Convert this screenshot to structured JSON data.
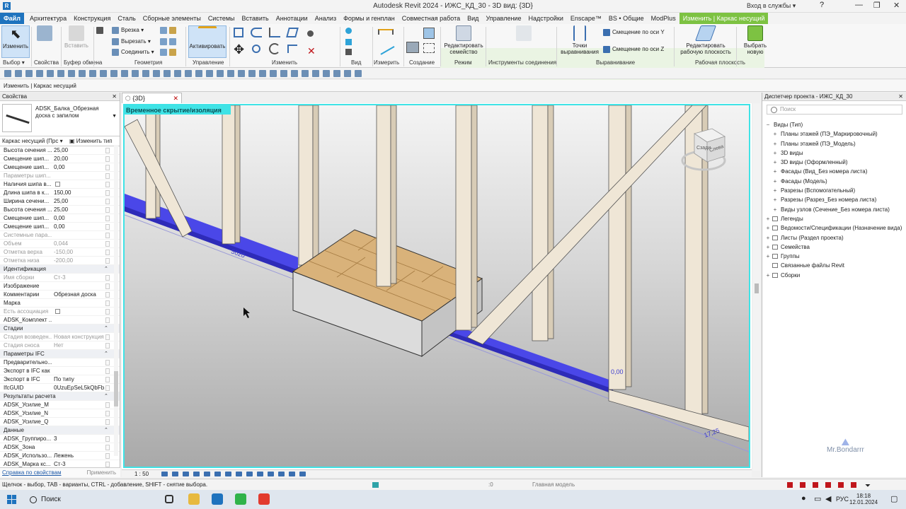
{
  "window": {
    "title": "Autodesk Revit 2024 - ИЖС_КД_30 - 3D вид: {3D}",
    "sign_in": "Вход в службы ▾",
    "controls": [
      "—",
      "❐",
      "✕"
    ]
  },
  "ribbon_tabs": [
    "Файл",
    "Архитектура",
    "Конструкция",
    "Сталь",
    "Сборные элементы",
    "Системы",
    "Вставить",
    "Аннотации",
    "Анализ",
    "Формы и генплан",
    "Совместная работа",
    "Вид",
    "Управление",
    "Надстройки",
    "Enscape™",
    "BS • Общие",
    "ModPlus",
    "Изменить | Каркас несущий"
  ],
  "ribbon": {
    "modify": "Изменить",
    "cut": "Врезка",
    "cut_out": "Вырезать",
    "join": "Соединить",
    "paste": "Вставить",
    "activate": "Активировать",
    "edit_family": "Редактировать семейство",
    "connection_tools": "Инструменты соединения",
    "alignment_points": "Точки выравнивания",
    "offset_y": "Смещение по оси Y",
    "offset_z": "Смещение по оси Z",
    "edit_workplane": "Редактировать рабочую плоскость",
    "pick_new": "Выбрать новую",
    "groups": [
      "Выбор ▾",
      "Свойства",
      "Буфер обмена",
      "Геометрия",
      "Управление",
      "Изменить",
      "Вид",
      "Измерить",
      "Создание",
      "Режим",
      "Инструменты соединения",
      "Выравнивание",
      "Рабочая плоскость"
    ]
  },
  "options_bar": "Изменить | Каркас несущий",
  "properties": {
    "title": "Свойства",
    "type_name": "ADSK_Балка_Обрезная доска с запилом",
    "filter": "Каркас несущий (Прс ▾",
    "edit_type": "Изменить тип",
    "rows": [
      {
        "k": "Высота сечения ...",
        "v": "25,00"
      },
      {
        "k": "Смещение шип...",
        "v": "20,00"
      },
      {
        "k": "Смещение шип...",
        "v": "0,00"
      },
      {
        "k": "Параметры шип...",
        "v": "",
        "dis": true
      },
      {
        "k": "Наличия шипа в...",
        "v": "",
        "cb": true
      },
      {
        "k": "Длина шипа в к...",
        "v": "150,00"
      },
      {
        "k": "Ширина сечени...",
        "v": "25,00"
      },
      {
        "k": "Высота сечения ...",
        "v": "25,00"
      },
      {
        "k": "Смещение шип...",
        "v": "0,00"
      },
      {
        "k": "Смещение шип...",
        "v": "0,00"
      },
      {
        "k": "Системные пара...",
        "v": "",
        "dis": true
      },
      {
        "k": "Объем",
        "v": "0,044",
        "dis": true
      },
      {
        "k": "Отметка верха",
        "v": "-150,00",
        "dis": true
      },
      {
        "k": "Отметка низа",
        "v": "-200,00",
        "dis": true
      },
      {
        "k": "Идентификация",
        "v": "",
        "sec": true
      },
      {
        "k": "Имя сборки",
        "v": "Ст-3",
        "dis": true
      },
      {
        "k": "Изображение",
        "v": ""
      },
      {
        "k": "Комментарии",
        "v": "Обрезная доска"
      },
      {
        "k": "Марка",
        "v": ""
      },
      {
        "k": "Есть ассоциация",
        "v": "",
        "dis": true,
        "cb": true
      },
      {
        "k": "ADSK_Комплект ...",
        "v": ""
      },
      {
        "k": "Стадии",
        "v": "",
        "sec": true
      },
      {
        "k": "Стадия возведен...",
        "v": "Новая конструкция",
        "dis": true
      },
      {
        "k": "Стадия сноса",
        "v": "Нет",
        "dis": true
      },
      {
        "k": "Параметры IFC",
        "v": "",
        "sec": true
      },
      {
        "k": "Предварительно...",
        "v": ""
      },
      {
        "k": "Экспорт в IFC как",
        "v": ""
      },
      {
        "k": "Экспорт в IFC",
        "v": "По типу"
      },
      {
        "k": "IfcGUID",
        "v": "0UzuEpSeL5kQbFb..."
      },
      {
        "k": "Результаты расчета",
        "v": "",
        "sec": true
      },
      {
        "k": "ADSK_Усилие_M",
        "v": ""
      },
      {
        "k": "ADSK_Усилие_N",
        "v": ""
      },
      {
        "k": "ADSK_Усилие_Q",
        "v": ""
      },
      {
        "k": "Данные",
        "v": "",
        "sec": true
      },
      {
        "k": "ADSK_Группиро...",
        "v": "3"
      },
      {
        "k": "ADSK_Зона",
        "v": ""
      },
      {
        "k": "ADSK_Использо...",
        "v": "Лежень"
      },
      {
        "k": "ADSK_Марка кс...",
        "v": "Ст-3"
      }
    ],
    "help_link": "Справка по свойствам",
    "apply": "Применить"
  },
  "view": {
    "tab_label": "{3D}",
    "temp_hide_label": "Временное скрытие/изоляция",
    "scale": "1 : 50",
    "viewcube_left": "Сзади",
    "viewcube_right": "Слева",
    "dim_a": "5020",
    "dim_b": "0,00",
    "dim_c": "17,25"
  },
  "browser": {
    "title": "Диспетчер проекта - ИЖС_КД_30",
    "search_placeholder": "Поиск",
    "nodes": [
      {
        "label": "Виды (Тип)",
        "lvl": 0,
        "tg": "−"
      },
      {
        "label": "Планы этажей (ПЭ_Маркировочный)",
        "lvl": 1,
        "tg": "+"
      },
      {
        "label": "Планы этажей (ПЭ_Модель)",
        "lvl": 1,
        "tg": "+"
      },
      {
        "label": "3D виды",
        "lvl": 1,
        "tg": "+"
      },
      {
        "label": "3D виды (Оформленный)",
        "lvl": 1,
        "tg": "+"
      },
      {
        "label": "Фасады (Вид_Без номера листа)",
        "lvl": 1,
        "tg": "+"
      },
      {
        "label": "Фасады (Модель)",
        "lvl": 1,
        "tg": "+"
      },
      {
        "label": "Разрезы (Вспомогательный)",
        "lvl": 1,
        "tg": "+"
      },
      {
        "label": "Разрезы (Разрез_Без номера листа)",
        "lvl": 1,
        "tg": "+"
      },
      {
        "label": "Виды узлов (Сечение_Без номера листа)",
        "lvl": 1,
        "tg": "+"
      },
      {
        "label": "Легенды",
        "lvl": 0,
        "tg": "+",
        "ic": true
      },
      {
        "label": "Ведомости/Спецификации (Назначение вида)",
        "lvl": 0,
        "tg": "+",
        "ic": true
      },
      {
        "label": "Листы (Раздел проекта)",
        "lvl": 0,
        "tg": "+",
        "ic": true
      },
      {
        "label": "Семейства",
        "lvl": 0,
        "tg": "+",
        "ic": true
      },
      {
        "label": "Группы",
        "lvl": 0,
        "tg": "+",
        "ic": true
      },
      {
        "label": "Связанные файлы Revit",
        "lvl": 0,
        "tg": "",
        "ic": true
      },
      {
        "label": "Сборки",
        "lvl": 0,
        "tg": "+",
        "ic": true
      }
    ]
  },
  "statusbar": {
    "hint": "Щелчок - выбор, TAB - варианты, CTRL - добавление, SHIFT - снятие выбора.",
    "zero": ":0",
    "model": "Главная модель"
  },
  "taskbar": {
    "search": "Поиск",
    "lang": "РУС",
    "time": "18:18",
    "date": "12.01.2024"
  },
  "watermark": "Mr.Bondarrr"
}
